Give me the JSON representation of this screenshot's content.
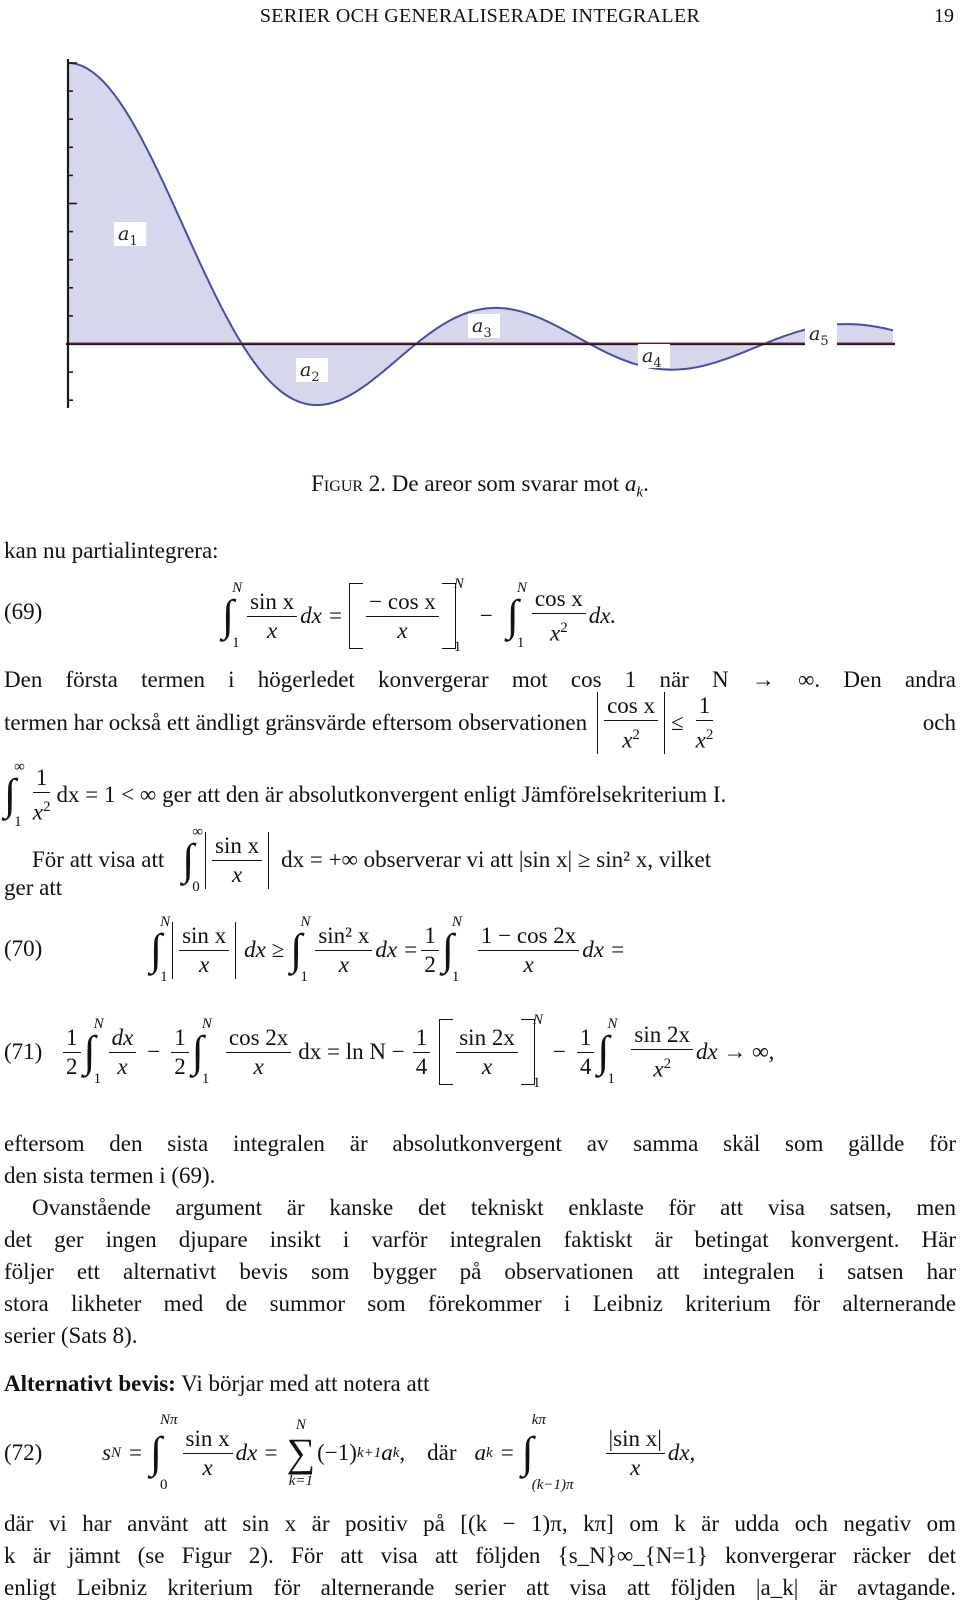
{
  "header": {
    "running_title": "SERIER OCH GENERALISERADE INTEGRALER",
    "page_number": "19"
  },
  "figure": {
    "caption_label": "Figur 2.",
    "caption_text": "De areor som svarar mot",
    "caption_symbol": "a",
    "caption_sub": "k",
    "caption_end": ".",
    "area_labels": [
      {
        "base": "a",
        "sub": "1"
      },
      {
        "base": "a",
        "sub": "2"
      },
      {
        "base": "a",
        "sub": "3"
      },
      {
        "base": "a",
        "sub": "4"
      },
      {
        "base": "a",
        "sub": "5"
      }
    ],
    "colors": {
      "fill": "#d6d7ec",
      "curve": "#4a4f9a",
      "axis": "#1a1a1a",
      "x_axis_line": "#7a2a4a"
    }
  },
  "chart_data": {
    "type": "area",
    "title": "",
    "function": "sin(x)/x",
    "xlabel": "",
    "ylabel": "",
    "xlim": [
      0,
      14.9
    ],
    "ylim": [
      -0.22,
      1.0
    ],
    "y_ticks_count_above_zero": 10,
    "y_ticks_count_below_zero": 2,
    "zero_crossings": [
      "π",
      "2π",
      "3π",
      "4π"
    ],
    "regions": [
      {
        "name": "a1",
        "from": "0",
        "to": "π",
        "sign": "positive"
      },
      {
        "name": "a2",
        "from": "π",
        "to": "2π",
        "sign": "negative"
      },
      {
        "name": "a3",
        "from": "2π",
        "to": "3π",
        "sign": "positive"
      },
      {
        "name": "a4",
        "from": "3π",
        "to": "4π",
        "sign": "negative"
      },
      {
        "name": "a5",
        "from": "4π",
        "to": "end",
        "sign": "positive"
      }
    ],
    "grid": false,
    "legend": "none"
  },
  "body": {
    "intro": "kan nu partialintegrera:",
    "eq69": {
      "number": "(69)",
      "int_upper": "N",
      "int_lower": "1",
      "f1_num": "sin x",
      "f1_den": "x",
      "dx": "dx =",
      "br_num": "− cos x",
      "br_den": "x",
      "br_upper": "N",
      "br_lower": "1",
      "minus": "−",
      "int2_upper": "N",
      "int2_lower": "1",
      "f2_num": "cos x",
      "f2_den": "x",
      "f2_den_sup": "2",
      "end": "dx."
    },
    "p1_line1": "Den första termen i högerledet konvergerar mot cos 1 när N → ∞.  Den andra",
    "p1_line2_text": "termen har också ett ändligt gränsvärde eftersom observationen",
    "p1_line2_frac_num": "cos x",
    "p1_line2_frac_den": "x",
    "p1_line2_le": "≤",
    "p1_line2_rfrac_num": "1",
    "p1_line2_rfrac_den": "x",
    "p1_line2_end": "och",
    "p1_line3_int_upper": "∞",
    "p1_line3_int_lower": "1",
    "p1_line3_frac_num": "1",
    "p1_line3_frac_den": "x",
    "p1_line3_text": "dx = 1 < ∞ ger att den är absolutkonvergent enligt Jämförelsekriterium I.",
    "p2_start": "För att visa att",
    "p2_int_upper": "∞",
    "p2_int_lower": "0",
    "p2_frac_num": "sin x",
    "p2_frac_den": "x",
    "p2_rest": "dx = +∞ observerar vi att  |sin x| ≥ sin² x, vilket",
    "p2_end": "ger att",
    "eq70": {
      "number": "(70)",
      "t1_num": "sin x",
      "t1_den": "x",
      "t1_dx": "dx ≥",
      "t2_num": "sin² x",
      "t2_den": "x",
      "t2_dx": "dx =",
      "half_num": "1",
      "half_den": "2",
      "t3_num": "1 − cos 2x",
      "t3_den": "x",
      "t3_dx": "dx =",
      "upper": "N",
      "lower": "1"
    },
    "eq71": {
      "number": "(71)",
      "h_num": "1",
      "h_den": "2",
      "a_num": "dx",
      "a_den": "x",
      "minus": "−",
      "b_num": "cos 2x",
      "b_den": "x",
      "mid": "dx = ln N −",
      "q_num": "1",
      "q_den": "4",
      "c_num": "sin 2x",
      "c_den": "x",
      "d_num": "sin 2x",
      "d_den": "x",
      "end": "dx → ∞,",
      "upper": "N",
      "lower": "1"
    },
    "p3_line1": "eftersom den sista integralen är absolutkonvergent av samma skäl som gällde för",
    "p3_line2": "den sista termen i (69).",
    "p4_lines": [
      "Ovanstående argument är kanske det tekniskt enklaste för att visa satsen, men",
      "det ger ingen djupare insikt i varför integralen faktiskt är betingat konvergent. Här",
      "följer ett alternativt bevis som bygger på observationen att integralen i satsen har",
      "stora likheter med de summor som förekommer i Leibniz kriterium för alternerande",
      "serier (Sats 8)."
    ],
    "alt_heading": "Alternativt bevis:",
    "alt_text": "Vi börjar med att notera att",
    "eq72": {
      "number": "(72)",
      "lhs": "s",
      "lhs_sub": "N",
      "eq": "=",
      "int_upper": "Nπ",
      "int_lower": "0",
      "f_num": "sin x",
      "f_den": "x",
      "dx": "dx =",
      "sum_upper": "N",
      "sum_lower": "k=1",
      "sum_term": "(−1)",
      "sum_sup": "k+1",
      "sum_a": "a",
      "sum_a_sub": "k",
      "comma": ",",
      "dar": "där",
      "ak": "a",
      "ak_sub": "k",
      "ak_eq": "=",
      "int2_upper": "kπ",
      "int2_lower": "(k−1)π",
      "g_num": "|sin x|",
      "g_den": "x",
      "end": "dx,"
    },
    "p5_lines": [
      "där vi har använt att sin x är positiv på [(k − 1)π, kπ] om k är udda och negativ om",
      "k är jämnt (se Figur 2). För att visa att följden {s_N}∞_{N=1} konvergerar räcker det",
      "enligt Leibniz kriterium för alternerande serier att visa att följden |a_k| är avtagande."
    ]
  }
}
